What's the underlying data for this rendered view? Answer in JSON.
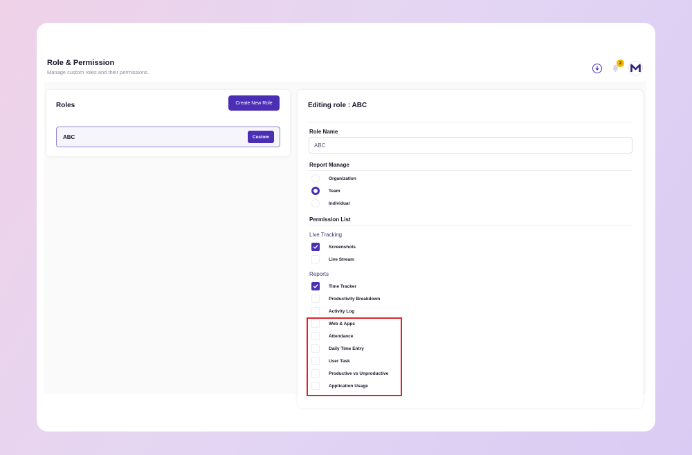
{
  "header": {
    "title": "Role & Permission",
    "subtitle": "Manage custom roles and their permissions.",
    "notification_count": "2"
  },
  "roles_panel": {
    "title": "Roles",
    "create_button": "Create New Role",
    "roles": [
      {
        "name": "ABC",
        "badge": "Custom"
      }
    ]
  },
  "edit_panel": {
    "title": "Editing role : ABC",
    "role_name_label": "Role Name",
    "role_name_value": "ABC",
    "report_manage_label": "Report Manage",
    "report_manage_options": [
      {
        "label": "Organization",
        "selected": false
      },
      {
        "label": "Team",
        "selected": true
      },
      {
        "label": "Individual",
        "selected": false
      }
    ],
    "permission_list_label": "Permission List",
    "live_tracking_label": "Live Tracking",
    "live_tracking": [
      {
        "label": "Screenshots",
        "checked": true
      },
      {
        "label": "Live Stream",
        "checked": false
      }
    ],
    "reports_label": "Reports",
    "reports": [
      {
        "label": "Time Tracker",
        "checked": true
      },
      {
        "label": "Productivity Breakdown",
        "checked": false
      },
      {
        "label": "Activity Log",
        "checked": false
      },
      {
        "label": "Web & Apps",
        "checked": false
      },
      {
        "label": "Attendance",
        "checked": false
      },
      {
        "label": "Daily Time Entry",
        "checked": false
      },
      {
        "label": "User Task",
        "checked": false
      },
      {
        "label": "Productive vs Unproductive",
        "checked": false
      },
      {
        "label": "Application Usage",
        "checked": false
      }
    ]
  },
  "colors": {
    "accent": "#4a2eb3",
    "highlight": "#e0232b"
  }
}
